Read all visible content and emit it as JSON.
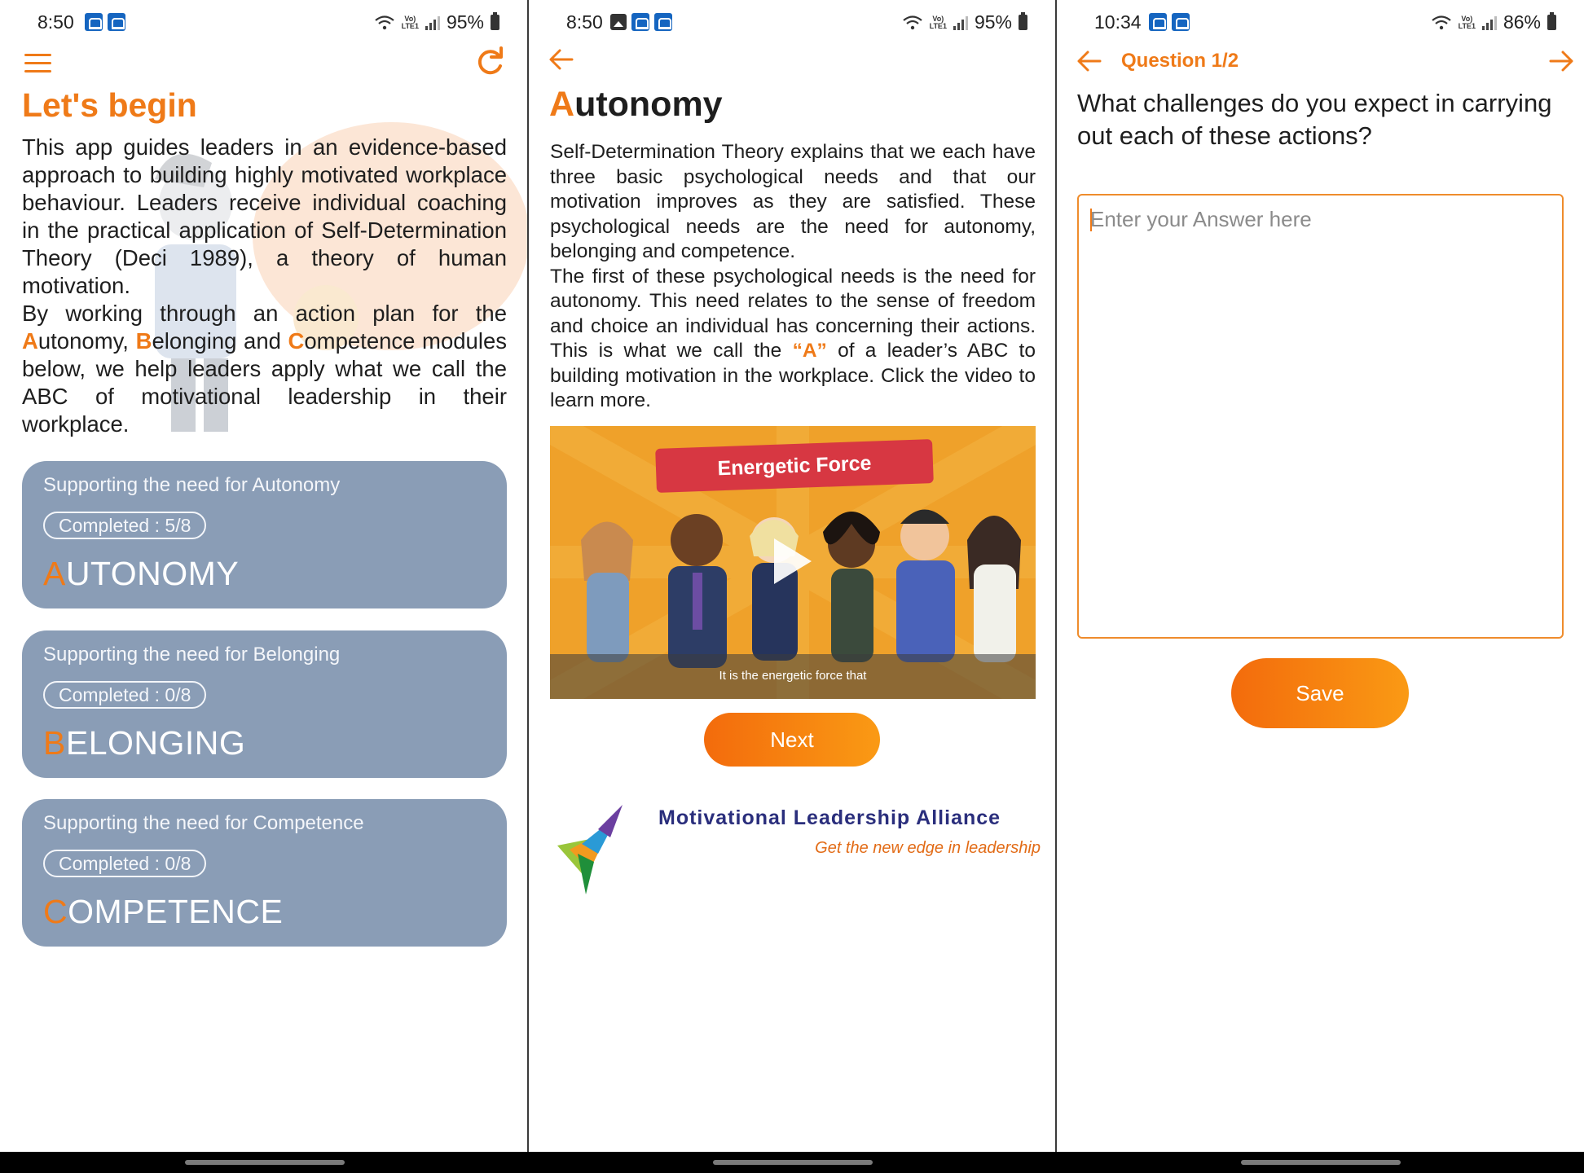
{
  "screen1": {
    "status": {
      "time": "8:50",
      "battery": "95%"
    },
    "title": "Let's begin",
    "intro_p1": "This app guides leaders in an evidence-based approach to building highly motivated workplace behaviour. Leaders receive individual coaching in the practical application of Self-Determination Theory (Deci 1989), a theory of human motivation.",
    "intro_p2_pre": "By working through an action plan for the ",
    "a_letter": "A",
    "a_rest": "utonomy, ",
    "b_letter": "B",
    "b_rest": "elonging and ",
    "c_letter": "C",
    "c_rest": "ompetence modules below, we help leaders apply what we call the ABC of motivational leadership in their workplace.",
    "modules": [
      {
        "subtitle": "Supporting the need for Autonomy",
        "completed": "Completed : 5/8",
        "first": "A",
        "rest": "UTONOMY"
      },
      {
        "subtitle": "Supporting the need for Belonging",
        "completed": "Completed : 0/8",
        "first": "B",
        "rest": "ELONGING"
      },
      {
        "subtitle": "Supporting the need for Competence",
        "completed": "Completed : 0/8",
        "first": "C",
        "rest": "OMPETENCE"
      }
    ]
  },
  "screen2": {
    "status": {
      "time": "8:50",
      "battery": "95%"
    },
    "title_first": "A",
    "title_rest": "utonomy",
    "body_p1": "Self-Determination Theory explains that we each have three basic psychological needs and that our motivation improves as they are satisfied. These psychological needs are the need for autonomy, belonging and competence.",
    "body_p2_pre": "The first of these psychological needs is the need for autonomy. This need relates to the sense of freedom and choice an individual has concerning their actions. This is what we call the ",
    "body_p2_hl": "“A”",
    "body_p2_post": " of a leader’s ABC to building motivation in the workplace. Click the video to learn more.",
    "video": {
      "banner": "Energetic Force",
      "caption": "It is the energetic force that"
    },
    "next_label": "Next",
    "logo": {
      "title": "Motivational Leadership Alliance",
      "tagline": "Get the new edge in leadership"
    }
  },
  "screen3": {
    "status": {
      "time": "10:34",
      "battery": "86%"
    },
    "question_label": "Question 1/2",
    "question": "What challenges do you expect in carrying out each of these actions?",
    "answer_placeholder": "Enter your Answer here",
    "save_label": "Save"
  },
  "colors": {
    "accent": "#ef7a18",
    "card": "#8a9db6",
    "navy": "#2a2e7c"
  }
}
